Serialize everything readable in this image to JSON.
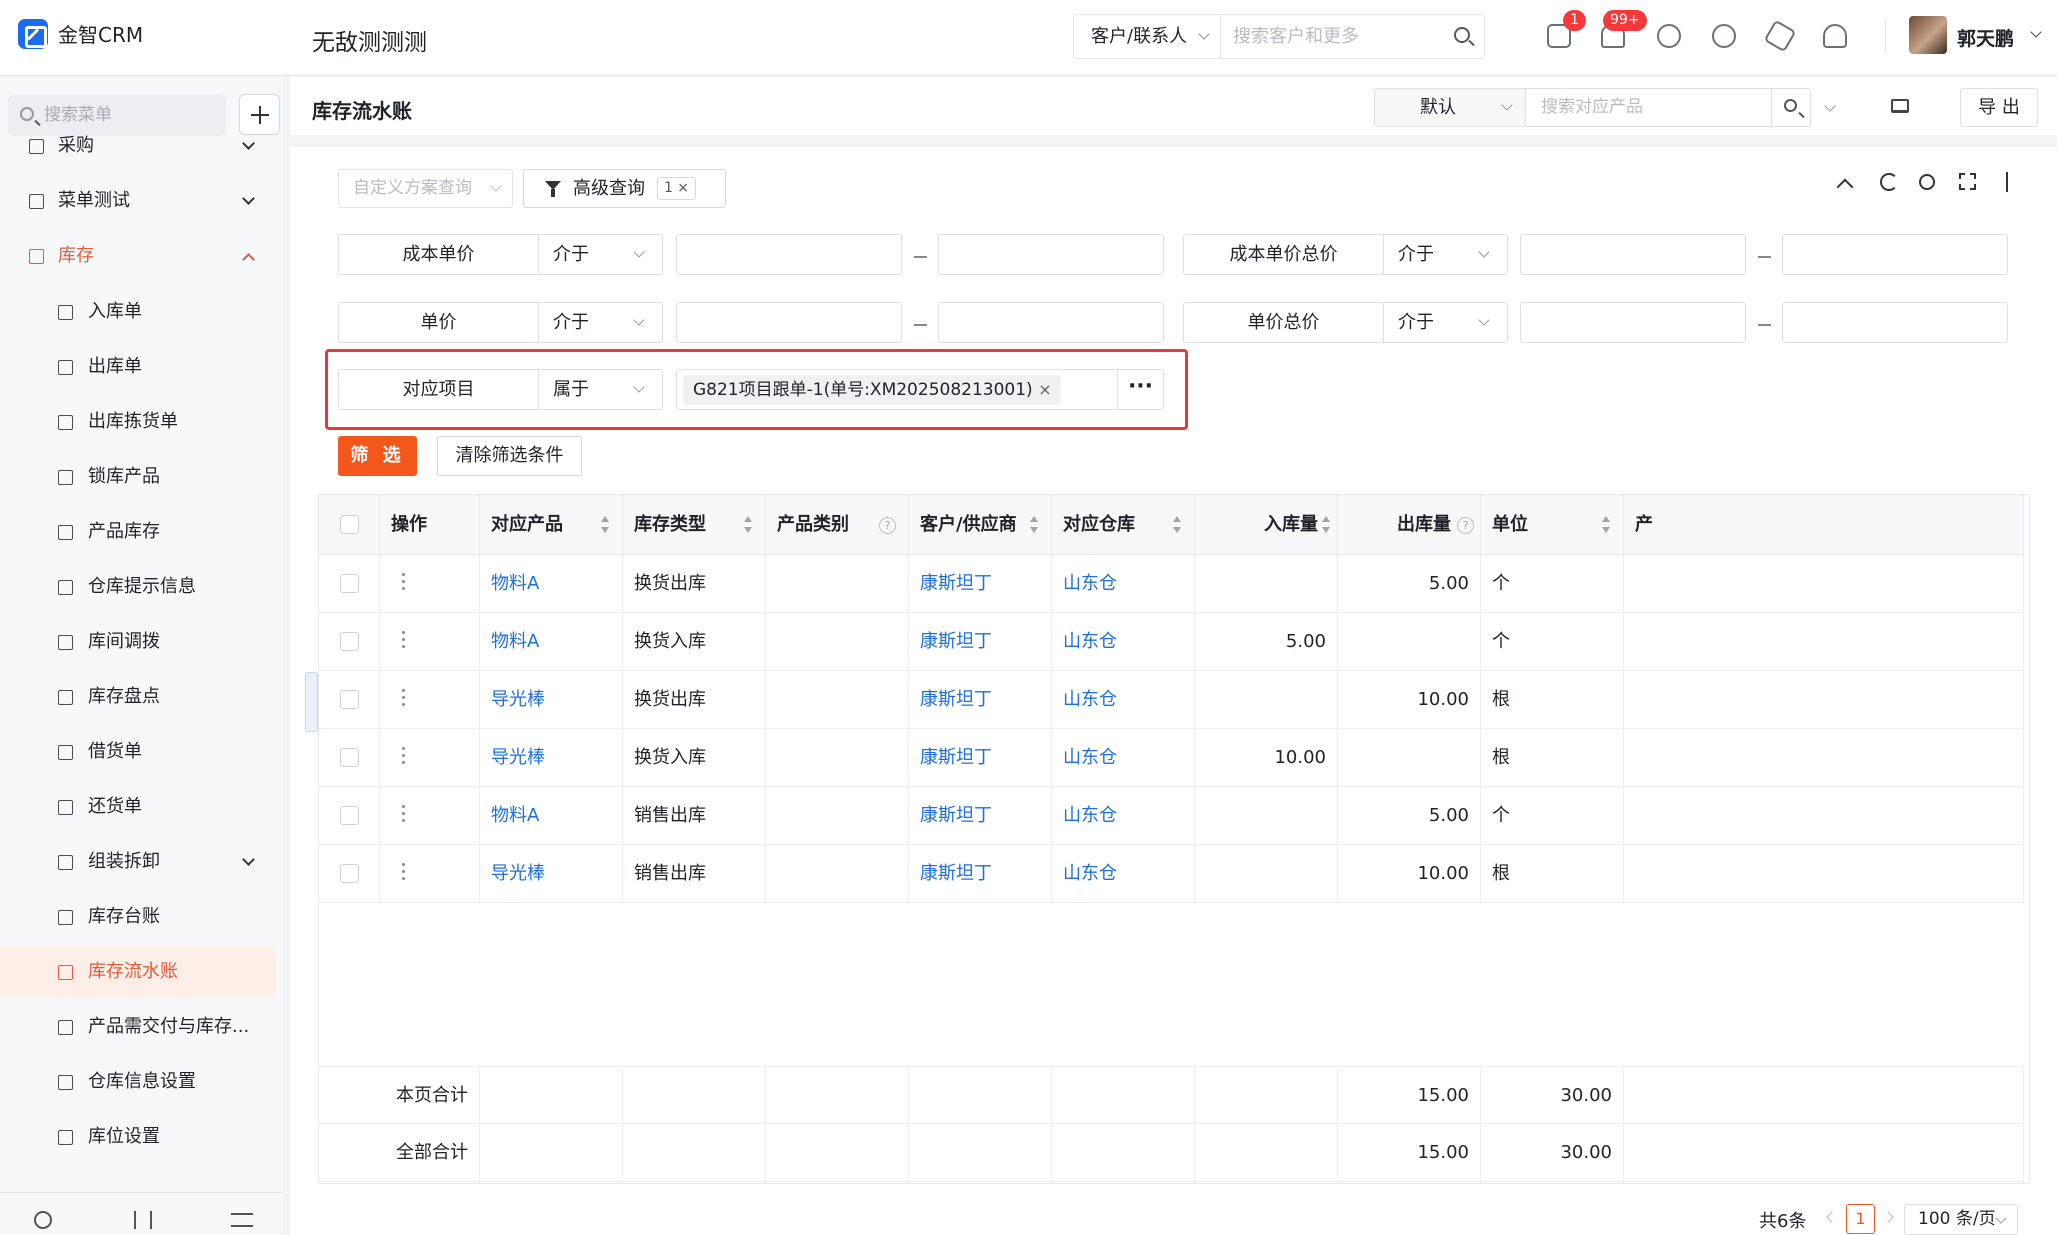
{
  "topbar": {
    "logo_text": "金智CRM",
    "app_title": "无敌测测测",
    "search_scope": "客户/联系人",
    "search_placeholder": "搜索客户和更多",
    "msg_badge": "1",
    "notif_badge": "99+",
    "user_name": "郭天鹏"
  },
  "sidebar": {
    "search_placeholder": "搜索菜单",
    "groups": [
      {
        "label": "采购",
        "icon": "purchase-icon"
      },
      {
        "label": "菜单测试",
        "icon": "menu-test-icon"
      },
      {
        "label": "库存",
        "icon": "inventory-icon"
      }
    ],
    "items": [
      {
        "label": "入库单",
        "icon": "inbound-icon"
      },
      {
        "label": "出库单",
        "icon": "outbound-icon"
      },
      {
        "label": "出库拣货单",
        "icon": "picking-icon"
      },
      {
        "label": "锁库产品",
        "icon": "lock-product-icon"
      },
      {
        "label": "产品库存",
        "icon": "product-stock-icon"
      },
      {
        "label": "仓库提示信息",
        "icon": "warehouse-tip-icon"
      },
      {
        "label": "库间调拨",
        "icon": "transfer-icon"
      },
      {
        "label": "库存盘点",
        "icon": "stocktake-icon"
      },
      {
        "label": "借货单",
        "icon": "borrow-icon"
      },
      {
        "label": "还货单",
        "icon": "return-icon"
      },
      {
        "label": "组装拆卸",
        "icon": "assembly-icon"
      },
      {
        "label": "库存台账",
        "icon": "ledger-icon"
      },
      {
        "label": "库存流水账",
        "icon": "journal-icon"
      },
      {
        "label": "产品需交付与库存...",
        "icon": "delivery-icon"
      },
      {
        "label": "仓库信息设置",
        "icon": "settings-icon"
      },
      {
        "label": "库位设置",
        "icon": "location-icon"
      }
    ]
  },
  "header": {
    "page_title": "库存流水账",
    "view_select": "默认",
    "product_search_placeholder": "搜索对应产品",
    "export_label": "导 出"
  },
  "filters": {
    "scheme_placeholder": "自定义方案查询",
    "advanced_label": "高级查询",
    "advanced_count": "1",
    "rows": [
      {
        "label": "成本单价",
        "op": "介于"
      },
      {
        "label": "成本单价总价",
        "op": "介于"
      },
      {
        "label": "单价",
        "op": "介于"
      },
      {
        "label": "单价总价",
        "op": "介于"
      },
      {
        "label": "对应项目",
        "op": "属于"
      }
    ],
    "project_tag": "G821项目跟单-1(单号:XM202508213001)",
    "more_label": "···",
    "filter_btn": "筛 选",
    "clear_btn": "清除筛选条件"
  },
  "table": {
    "columns": [
      "操作",
      "对应产品",
      "库存类型",
      "产品类别",
      "客户/供应商",
      "对应仓库",
      "入库量",
      "出库量",
      "单位",
      "产"
    ],
    "rows": [
      {
        "product": "物料A",
        "type": "换货出库",
        "category": "",
        "customer": "康斯坦丁",
        "warehouse": "山东仓",
        "in_qty": "",
        "out_qty": "5.00",
        "unit": "个"
      },
      {
        "product": "物料A",
        "type": "换货入库",
        "category": "",
        "customer": "康斯坦丁",
        "warehouse": "山东仓",
        "in_qty": "5.00",
        "out_qty": "",
        "unit": "个"
      },
      {
        "product": "导光棒",
        "type": "换货出库",
        "category": "",
        "customer": "康斯坦丁",
        "warehouse": "山东仓",
        "in_qty": "",
        "out_qty": "10.00",
        "unit": "根"
      },
      {
        "product": "导光棒",
        "type": "换货入库",
        "category": "",
        "customer": "康斯坦丁",
        "warehouse": "山东仓",
        "in_qty": "10.00",
        "out_qty": "",
        "unit": "根"
      },
      {
        "product": "物料A",
        "type": "销售出库",
        "category": "",
        "customer": "康斯坦丁",
        "warehouse": "山东仓",
        "in_qty": "",
        "out_qty": "5.00",
        "unit": "个"
      },
      {
        "product": "导光棒",
        "type": "销售出库",
        "category": "",
        "customer": "康斯坦丁",
        "warehouse": "山东仓",
        "in_qty": "",
        "out_qty": "10.00",
        "unit": "根"
      }
    ],
    "totals": [
      {
        "label": "本页合计",
        "in_qty": "15.00",
        "out_qty": "30.00"
      },
      {
        "label": "全部合计",
        "in_qty": "15.00",
        "out_qty": "30.00"
      }
    ]
  },
  "pager": {
    "total": "共6条",
    "current": "1",
    "page_size": "100 条/页"
  },
  "colors": {
    "accent": "#f4571c",
    "link": "#1e6fdc",
    "highlight": "#e5393b"
  }
}
